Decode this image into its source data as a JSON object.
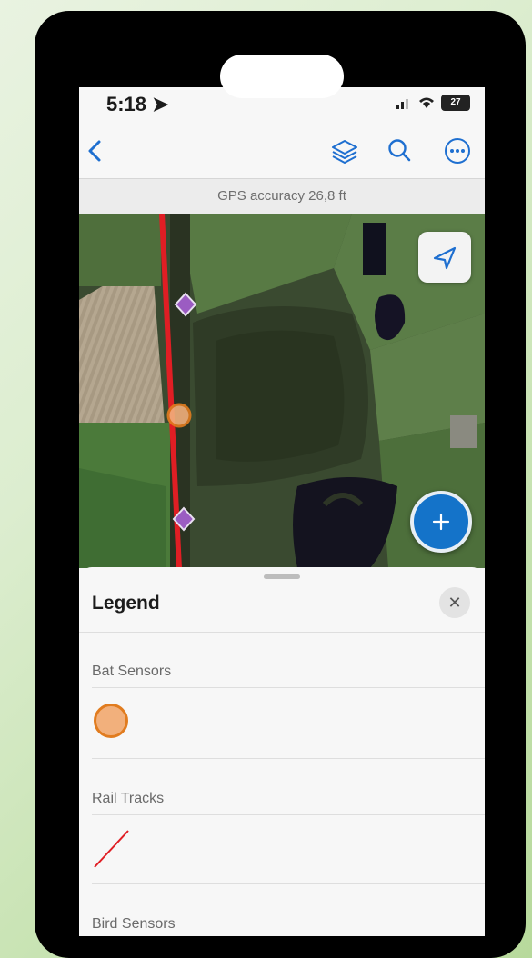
{
  "status_bar": {
    "time": "5:18",
    "battery": "27"
  },
  "nav": {
    "back": "back",
    "icons": [
      "layers-icon",
      "search-icon",
      "more-icon"
    ]
  },
  "gps": {
    "text": "GPS accuracy 26,8 ft"
  },
  "map": {
    "layers": [
      "Bat Sensors",
      "Rail Tracks",
      "Bird Sensors"
    ],
    "colors": {
      "rail": "#e01e24",
      "bird": "#9b5cc2",
      "bat_fill": "#f2b07c",
      "bat_stroke": "#e17c1f",
      "fab": "#1473c9"
    }
  },
  "legend": {
    "title": "Legend",
    "close": "✕",
    "sections": [
      {
        "label": "Bat Sensors"
      },
      {
        "label": "Rail Tracks"
      },
      {
        "label": "Bird Sensors"
      }
    ]
  }
}
